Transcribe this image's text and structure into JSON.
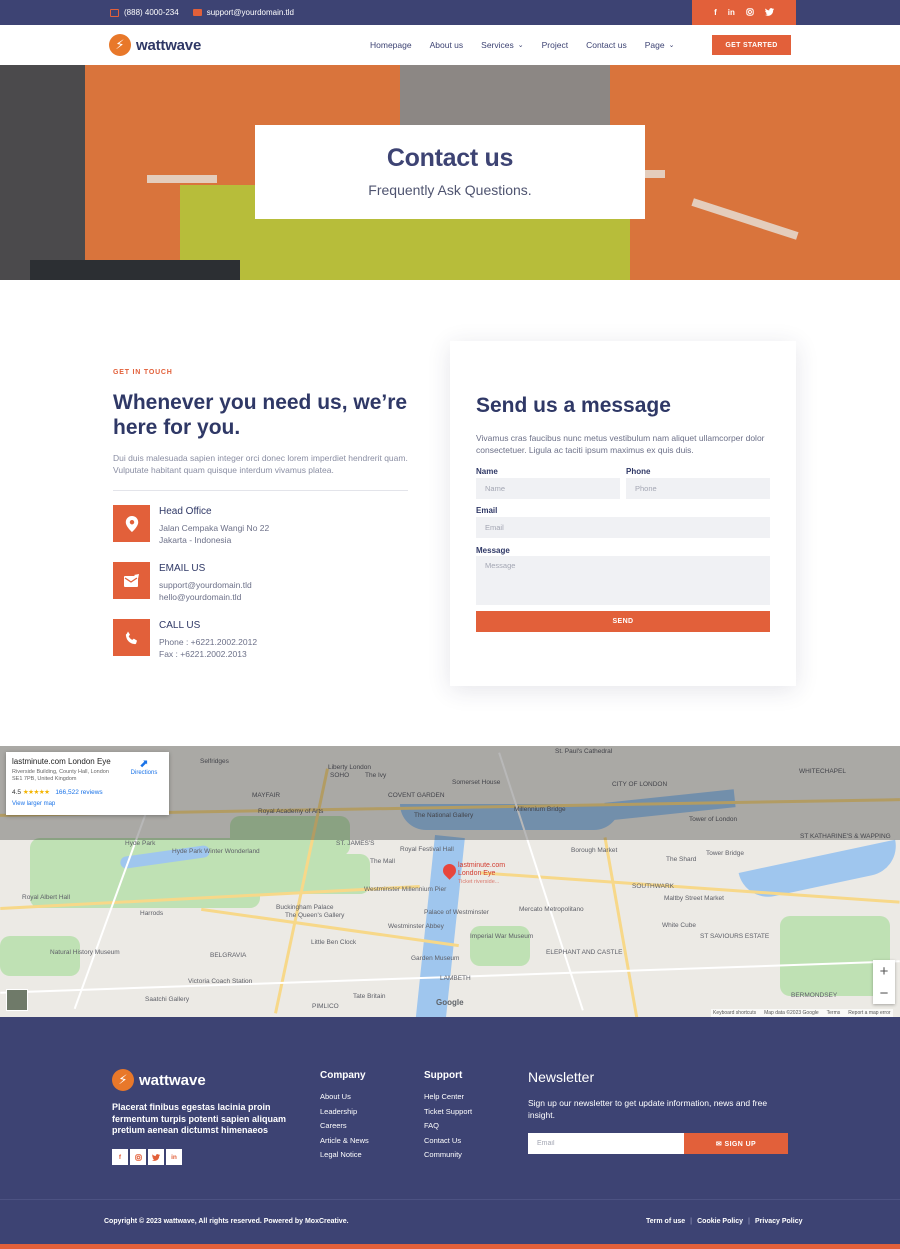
{
  "topbar": {
    "phone": "(888) 4000-234",
    "email": "support@yourdomain.tld",
    "social_icons": [
      "facebook-icon",
      "linkedin-icon",
      "instagram-icon",
      "twitter-icon"
    ]
  },
  "header": {
    "logo_text": "wattwave",
    "nav": [
      {
        "label": "Homepage"
      },
      {
        "label": "About us"
      },
      {
        "label": "Services"
      },
      {
        "label": "Project"
      },
      {
        "label": "Contact us"
      },
      {
        "label": "Page"
      }
    ],
    "cta_label": "GET STARTED"
  },
  "hero": {
    "title": "Contact us",
    "subtitle": "Frequently Ask Questions."
  },
  "contact": {
    "eyebrow": "GET IN TOUCH",
    "title": "Whenever you need us, we’re here for you.",
    "intro": "Dui duis malesuada sapien integer orci donec lorem imperdiet hendrerit quam. Vulputate habitant quam quisque interdum vivamus platea.",
    "items": [
      {
        "title": "Head Office",
        "line1": "Jalan Cempaka Wangi No 22",
        "line2": "Jakarta - Indonesia",
        "icon": "location-pin-icon"
      },
      {
        "title": "EMAIL US",
        "line1": "support@yourdomain.tld",
        "line2": "hello@yourdomain.tld",
        "icon": "mail-icon"
      },
      {
        "title": "CALL US",
        "line1": "Phone : +6221.2002.2012",
        "line2": "Fax : +6221.2002.2013",
        "icon": "phone-icon"
      }
    ]
  },
  "form": {
    "title": "Send us a message",
    "description": "Vivamus cras faucibus nunc metus vestibulum nam aliquet ullamcorper dolor consectetuer. Ligula ac taciti ipsum maximus ex quis duis.",
    "name_label": "Name",
    "name_placeholder": "Name",
    "phone_label": "Phone",
    "phone_placeholder": "Phone",
    "email_label": "Email",
    "email_placeholder": "Email",
    "message_label": "Message",
    "message_placeholder": "Message",
    "send_label": "SEND"
  },
  "map": {
    "place_name": "lastminute.com London Eye",
    "address": "Riverside Building, County Hall, London SE1 7PB, United Kingdom",
    "rating": "4.5",
    "stars": "★★★★★",
    "reviews": "166,522 reviews",
    "larger_map": "View larger map",
    "directions": "Directions",
    "pin_label_1": "lastminute.com",
    "pin_label_2": "London Eye",
    "pin_label_3": "Ticket riverside...",
    "google": "Google",
    "zoom_in": "+",
    "zoom_out": "−",
    "footer_links": [
      "Keyboard shortcuts",
      "Map data ©2023 Google",
      "Terms",
      "Report a map error"
    ],
    "labels": [
      "Selfridges",
      "MAYFAIR",
      "SOHO",
      "The Ivy",
      "Liberty London",
      "COVENT GARDEN",
      "Somerset House",
      "St. Paul's Cathedral",
      "CITY OF LONDON",
      "WHITECHAPEL",
      "Royal Academy of Arts",
      "The National Gallery",
      "Millennium Bridge",
      "Tower of London",
      "ST KATHARINE'S & WAPPING",
      "Hyde Park",
      "Hyde Park Winter Wonderland",
      "ST. JAMES'S",
      "The Mall",
      "Royal Festival Hall",
      "Borough Market",
      "The Shard",
      "Tower Bridge",
      "Royal Albert Hall",
      "Buckingham Palace",
      "Westminster Millennium Pier",
      "Palace of Westminster",
      "Mercato Metropolitano",
      "Maltby Street Market",
      "SOUTHWARK",
      "Harrods",
      "BELGRAVIA",
      "The Queen's Gallery",
      "Westminster Abbey",
      "Imperial War Museum",
      "White Cube",
      "ST SAVIOURS ESTATE",
      "Natural History Museum",
      "Little Ben Clock",
      "ELEPHANT AND CASTLE",
      "Garden Museum",
      "LAMBETH",
      "Victoria Coach Station",
      "Saatchi Gallery",
      "PIMLICO",
      "Tate Britain",
      "BERMONDSEY"
    ]
  },
  "footer": {
    "logo_text": "wattwave",
    "description": "Placerat finibus egestas lacinia proin fermentum turpis potenti sapien aliquam pretium aenean dictumst himenaeos",
    "social_icons": [
      "facebook-icon",
      "instagram-icon",
      "twitter-icon",
      "linkedin-icon"
    ],
    "company_title": "Company",
    "company_links": [
      "About Us",
      "Leadership",
      "Careers",
      "Article & News",
      "Legal Notice"
    ],
    "support_title": "Support",
    "support_links": [
      "Help Center",
      "Ticket Support",
      "FAQ",
      "Contact Us",
      "Community"
    ],
    "newsletter_title": "Newsletter",
    "newsletter_desc": "Sign up our newsletter to get update information, news and free insight.",
    "newsletter_placeholder": "Email",
    "newsletter_button": "SIGN UP",
    "copyright": "Copyright © 2023 wattwave, All rights reserved. Powered by MoxCreative.",
    "legal_links": [
      "Term of use",
      "Cookie Policy",
      "Privacy Policy"
    ]
  },
  "colors": {
    "navy": "#3d4373",
    "accent": "#e2603a",
    "text_dark": "#2f3866"
  }
}
